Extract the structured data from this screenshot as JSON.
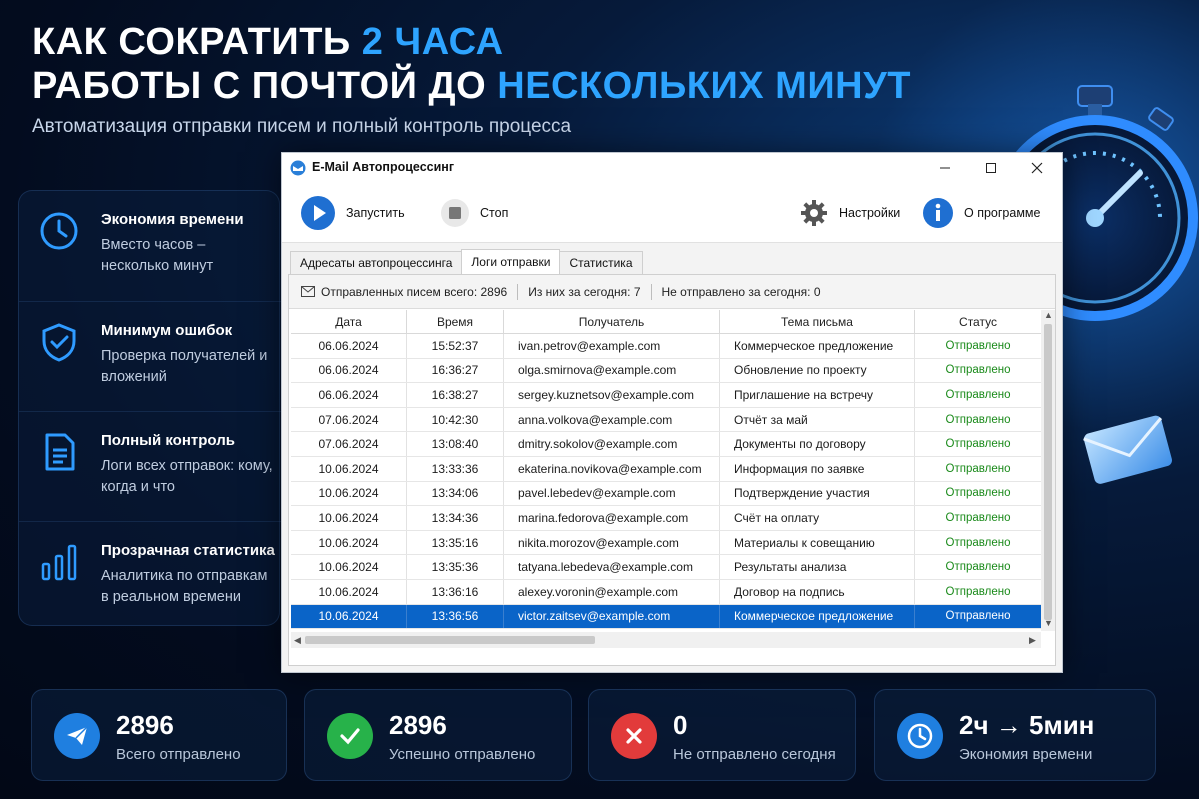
{
  "hero": {
    "line1_a": "Как сократить ",
    "line1_accent": "2 часа",
    "line2_a": "работы с почтой до ",
    "line2_accent": "нескольких минут",
    "subtitle": "Автоматизация отправки писем и полный контроль процесса"
  },
  "features": [
    {
      "icon": "clock-icon",
      "title": "Экономия времени",
      "desc": "Вместо часов – несколько минут"
    },
    {
      "icon": "shield-check-icon",
      "title": "Минимум ошибок",
      "desc": "Проверка получателей и вложений"
    },
    {
      "icon": "document-icon",
      "title": "Полный контроль",
      "desc": "Логи всех отправок: кому, когда и что"
    },
    {
      "icon": "bar-chart-icon",
      "title": "Прозрачная статистика",
      "desc": "Аналитика по отправкам в реальном времени"
    }
  ],
  "window": {
    "title": "E-Mail Автопроцессинг",
    "toolbar": {
      "start": "Запустить",
      "stop": "Стоп",
      "settings": "Настройки",
      "about": "О программе"
    },
    "tabs": [
      "Адресаты автопроцессинга",
      "Логи отправки",
      "Статистика"
    ],
    "active_tab": 1,
    "statbar": {
      "total": "Отправленных писем всего: 2896",
      "today": "Из них за сегодня: 7",
      "failed": "Не отправлено за сегодня: 0"
    },
    "columns": [
      "Дата",
      "Время",
      "Получатель",
      "Тема письма",
      "Статус"
    ],
    "rows": [
      [
        "06.06.2024",
        "15:52:37",
        "ivan.petrov@example.com",
        "Коммерческое предложение",
        "Отправлено"
      ],
      [
        "06.06.2024",
        "16:36:27",
        "olga.smirnova@example.com",
        "Обновление по проекту",
        "Отправлено"
      ],
      [
        "06.06.2024",
        "16:38:27",
        "sergey.kuznetsov@example.com",
        "Приглашение на встречу",
        "Отправлено"
      ],
      [
        "07.06.2024",
        "10:42:30",
        "anna.volkova@example.com",
        "Отчёт за май",
        "Отправлено"
      ],
      [
        "07.06.2024",
        "13:08:40",
        "dmitry.sokolov@example.com",
        "Документы по договору",
        "Отправлено"
      ],
      [
        "10.06.2024",
        "13:33:36",
        "ekaterina.novikova@example.com",
        "Информация по заявке",
        "Отправлено"
      ],
      [
        "10.06.2024",
        "13:34:06",
        "pavel.lebedev@example.com",
        "Подтверждение участия",
        "Отправлено"
      ],
      [
        "10.06.2024",
        "13:34:36",
        "marina.fedorova@example.com",
        "Счёт на оплату",
        "Отправлено"
      ],
      [
        "10.06.2024",
        "13:35:16",
        "nikita.morozov@example.com",
        "Материалы к совещанию",
        "Отправлено"
      ],
      [
        "10.06.2024",
        "13:35:36",
        "tatyana.lebedeva@example.com",
        "Результаты анализа",
        "Отправлено"
      ],
      [
        "10.06.2024",
        "13:36:16",
        "alexey.voronin@example.com",
        "Договор на подпись",
        "Отправлено"
      ],
      [
        "10.06.2024",
        "13:36:56",
        "victor.zaitsev@example.com",
        "Коммерческое предложение",
        "Отправлено"
      ]
    ],
    "selected_row": 11
  },
  "cards": [
    {
      "icon": "send-icon",
      "color": "#1f7fe0",
      "value": "2896",
      "label": "Всего отправлено"
    },
    {
      "icon": "check-icon",
      "color": "#27b24a",
      "value": "2896",
      "label": "Успешно отправлено"
    },
    {
      "icon": "x-icon",
      "color": "#e23b3b",
      "value": "0",
      "label": "Не отправлено сегодня"
    },
    {
      "icon": "clock-icon",
      "color": "#1f7fe0",
      "value": "2ч → 5мин",
      "label": "Экономия времени"
    }
  ]
}
